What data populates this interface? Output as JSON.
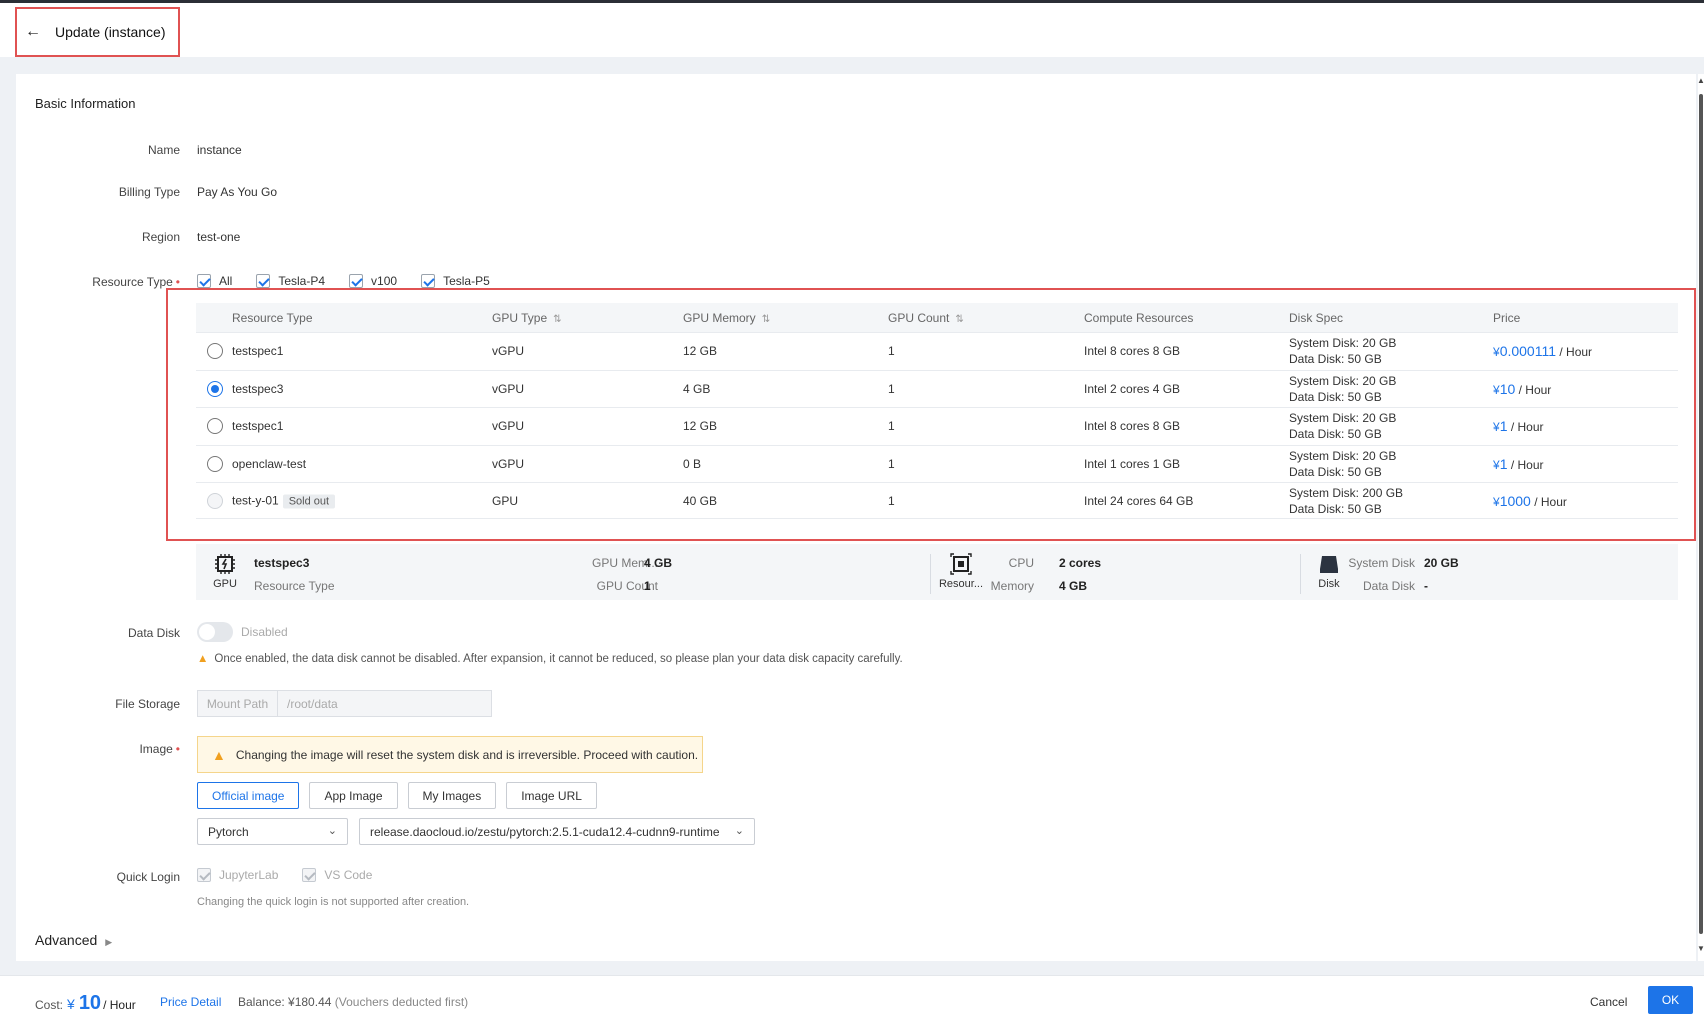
{
  "header": {
    "back_icon": "arrow-left-icon",
    "title": "Update (instance)"
  },
  "basic": {
    "section_title": "Basic Information",
    "name_label": "Name",
    "name_value": "instance",
    "billing_label": "Billing Type",
    "billing_value": "Pay As You Go",
    "region_label": "Region",
    "region_value": "test-one",
    "resource_label": "Resource Type",
    "resource_filters": [
      "All",
      "Tesla-P4",
      "v100",
      "Tesla-P5"
    ]
  },
  "table": {
    "headers": [
      "Resource Type",
      "GPU Type",
      "GPU Memory",
      "GPU Count",
      "Compute Resources",
      "Disk Spec",
      "Price"
    ],
    "rows": [
      {
        "name": "testspec1",
        "gpu_type": "vGPU",
        "gpu_mem": "12 GB",
        "gpu_count": "1",
        "compute": "Intel 8 cores 8 GB",
        "sys_disk": "System Disk: 20 GB",
        "data_disk": "Data Disk: 50 GB",
        "yen": "¥",
        "price": "0.000111",
        "unit": "/ Hour",
        "selected": false,
        "sold_out": false
      },
      {
        "name": "testspec3",
        "gpu_type": "vGPU",
        "gpu_mem": "4 GB",
        "gpu_count": "1",
        "compute": "Intel 2 cores 4 GB",
        "sys_disk": "System Disk: 20 GB",
        "data_disk": "Data Disk: 50 GB",
        "yen": "¥",
        "price": "10",
        "unit": "/ Hour",
        "selected": true,
        "sold_out": false
      },
      {
        "name": "testspec1",
        "gpu_type": "vGPU",
        "gpu_mem": "12 GB",
        "gpu_count": "1",
        "compute": "Intel 8 cores 8 GB",
        "sys_disk": "System Disk: 20 GB",
        "data_disk": "Data Disk: 50 GB",
        "yen": "¥",
        "price": "1",
        "unit": "/ Hour",
        "selected": false,
        "sold_out": false
      },
      {
        "name": "openclaw-test",
        "gpu_type": "vGPU",
        "gpu_mem": "0 B",
        "gpu_count": "1",
        "compute": "Intel 1 cores 1 GB",
        "sys_disk": "System Disk: 20 GB",
        "data_disk": "Data Disk: 50 GB",
        "yen": "¥",
        "price": "1",
        "unit": "/ Hour",
        "selected": false,
        "sold_out": false
      },
      {
        "name": "test-y-01",
        "sold_label": "Sold out",
        "gpu_type": "GPU",
        "gpu_mem": "40 GB",
        "gpu_count": "1",
        "compute": "Intel 24 cores 64 GB",
        "sys_disk": "System Disk: 200 GB",
        "data_disk": "Data Disk: 50 GB",
        "yen": "¥",
        "price": "1000",
        "unit": "/ Hour",
        "selected": false,
        "sold_out": true
      }
    ]
  },
  "summary": {
    "gpu_icon_label": "GPU",
    "spec_name": "testspec3",
    "spec_caption": "Resource Type",
    "gpu_mem_key": "GPU Mem...",
    "gpu_mem_val": "4 GB",
    "gpu_count_key": "GPU Count",
    "gpu_count_val": "1",
    "res_icon_label": "Resour...",
    "cpu_key": "CPU",
    "cpu_val": "2 cores",
    "mem_key": "Memory",
    "mem_val": "4 GB",
    "disk_icon_label": "Disk",
    "sys_disk_key": "System Disk",
    "sys_disk_val": "20 GB",
    "data_disk_key": "Data Disk",
    "data_disk_val": "-"
  },
  "data_disk": {
    "label": "Data Disk",
    "toggle_text": "Disabled",
    "enabled": false,
    "warning": "Once enabled, the data disk cannot be disabled. After expansion, it cannot be reduced, so please plan your data disk capacity carefully."
  },
  "file_storage": {
    "label": "File Storage",
    "prefix": "Mount Path",
    "path": "/root/data"
  },
  "image": {
    "label": "Image",
    "alert": "Changing the image will reset the system disk and is irreversible. Proceed with caution.",
    "tabs": [
      "Official image",
      "App Image",
      "My Images",
      "Image URL"
    ],
    "active_tab": "Official image",
    "framework": "Pytorch",
    "image_url": "release.daocloud.io/zestu/pytorch:2.5.1-cuda12.4-cudnn9-runtime"
  },
  "quick_login": {
    "label": "Quick Login",
    "options": [
      "JupyterLab",
      "VS Code"
    ],
    "note": "Changing the quick login is not supported after creation."
  },
  "advanced": {
    "label": "Advanced"
  },
  "footer": {
    "cost_label": "Cost:",
    "yen": "¥",
    "cost_value": "10",
    "cost_unit": "/ Hour",
    "price_detail": "Price Detail",
    "balance": "Balance: ¥180.44",
    "balance_note": "(Vouchers deducted first)",
    "cancel": "Cancel",
    "ok": "OK"
  },
  "colors": {
    "accent": "#1d74e8",
    "highlight_border": "#e05252",
    "warning": "#f0a020"
  }
}
